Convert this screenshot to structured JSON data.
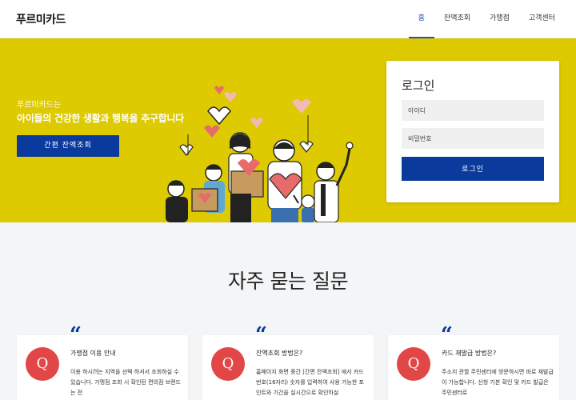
{
  "header": {
    "logo": "푸르미카드",
    "nav": [
      {
        "label": "홈",
        "active": true
      },
      {
        "label": "잔액조회",
        "active": false
      },
      {
        "label": "가맹점",
        "active": false
      },
      {
        "label": "고객센터",
        "active": false
      }
    ]
  },
  "hero": {
    "subtitle": "푸르미카드는",
    "title": "아이들의 건강한 생활과 행복을 추구합니다",
    "quick_button": "간편 잔액조회",
    "background_color": "#ddca00",
    "illustration": "family-with-hearts-illustration"
  },
  "login": {
    "title": "로그인",
    "id_placeholder": "아이디",
    "pw_placeholder": "비밀번호",
    "submit_label": "로그인",
    "button_color": "#0b3a9d"
  },
  "faq": {
    "heading": "자주 묻는 질문",
    "badge_letter": "Q",
    "quote_mark": "“",
    "badge_color": "#e24747",
    "items": [
      {
        "title": "가맹점 이용 안내",
        "body": "이용 하시려는 지역을 선택 하셔서 조회하실 수 있습니다. 가맹점 조회 시 확인된 편의점 브랜드는 전"
      },
      {
        "title": "잔액조회 방법은?",
        "body": "홈페이지 화면 중간 [간편 잔액조회] 에서 카드번호(16자리) 숫자를 입력하여 사용 가능한 포인트와 기간을 실시간으로 확인하실"
      },
      {
        "title": "카드 재발급 방법은?",
        "body": "주소지 관할 주민센터에 방문하시면 바로 재발급이 가능합니다. 신청 기본 확인 및 카드 발급은 주민센터로"
      }
    ]
  }
}
